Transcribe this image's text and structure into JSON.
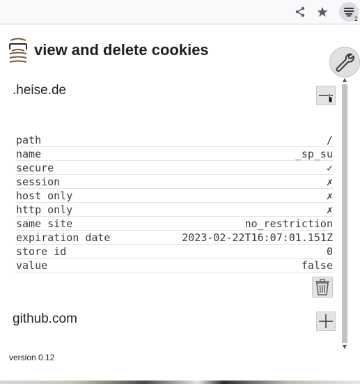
{
  "toolbar": {
    "share_icon": "share-icon",
    "bookmark_icon": "star-icon",
    "extension_icon": "extension-menu-icon",
    "extension_badge": "2"
  },
  "popup": {
    "title": "view and delete cookies",
    "settings_icon": "wrench-icon",
    "version": "version 0.12"
  },
  "cookies": [
    {
      "domain": ".heise.de",
      "expanded": true,
      "toggle_icon": "minus-icon",
      "properties": [
        {
          "key": "path",
          "value": "/"
        },
        {
          "key": "name",
          "value": "_sp_su"
        },
        {
          "key": "secure",
          "value": "✓"
        },
        {
          "key": "session",
          "value": "✗"
        },
        {
          "key": "host only",
          "value": "✗"
        },
        {
          "key": "http only",
          "value": "✗"
        },
        {
          "key": "same site",
          "value": "no_restriction"
        },
        {
          "key": "expiration date",
          "value": "2023-02-22T16:07:01.151Z"
        },
        {
          "key": "store id",
          "value": "0"
        },
        {
          "key": "value",
          "value": "false"
        }
      ],
      "delete_icon": "trash-icon"
    },
    {
      "domain": "github.com",
      "expanded": false,
      "toggle_icon": "plus-icon"
    }
  ],
  "colors": {
    "button_bg": "#e4e4e4",
    "text": "#1f1f1f",
    "mono_text": "#3a3a3a"
  }
}
